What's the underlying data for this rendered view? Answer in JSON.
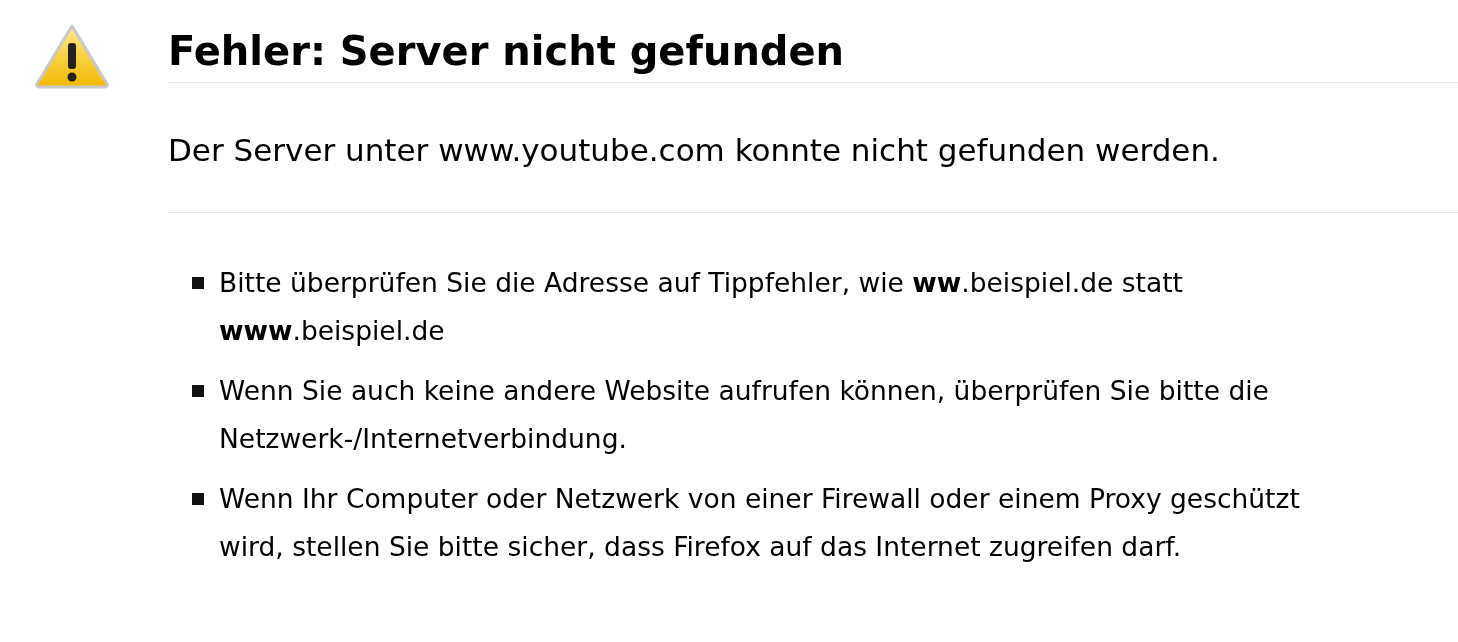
{
  "title": "Fehler: Server nicht gefunden",
  "message": "Der Server unter www.youtube.com konnte nicht gefunden werden.",
  "suggestions": [
    "Bitte überprüfen Sie die Adresse auf Tippfehler, wie **ww**.beispiel.de statt **www**.beispiel.de",
    "Wenn Sie auch keine andere Website aufrufen können, überprüfen Sie bitte die Netzwerk-/Internetverbindung.",
    "Wenn Ihr Computer oder Netzwerk von einer Firewall oder einem Proxy geschützt wird, stellen Sie bitte sicher, dass Firefox auf das Internet zugreifen darf."
  ]
}
